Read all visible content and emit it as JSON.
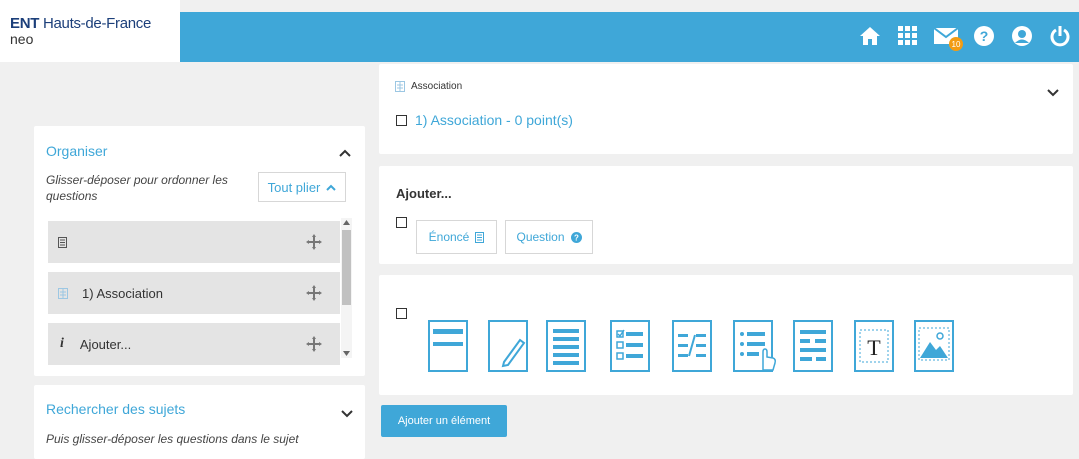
{
  "header": {
    "logo_ent": "ENT",
    "logo_region": "Hauts-de-France",
    "logo_sub": "neo",
    "icons": [
      "home-icon",
      "apps-grid-icon",
      "mail-icon",
      "help-icon",
      "user-icon",
      "power-icon"
    ],
    "mail_badge": "10"
  },
  "organiser": {
    "title": "Organiser",
    "instruction": "Glisser-déposer pour ordonner les questions",
    "collapse_button": "Tout plier",
    "items": [
      {
        "label": ""
      },
      {
        "label": "1) Association"
      },
      {
        "label": "Ajouter..."
      }
    ]
  },
  "recherche": {
    "title": "Rechercher des sujets",
    "instruction": "Puis glisser-déposer les questions dans le sujet"
  },
  "association_card": {
    "type_label": "Association",
    "question_title": "1) Association - 0 point(s)"
  },
  "ajouter_card": {
    "title": "Ajouter...",
    "enonce_button": "Énoncé",
    "question_button": "Question"
  },
  "elements": {
    "tiles": [
      "statement",
      "open-answer",
      "long-text",
      "multiple-choice",
      "association",
      "qcm-click",
      "fill-text",
      "text-block",
      "image"
    ]
  },
  "add_element_button": "Ajouter un élément",
  "colors": {
    "accent": "#3fa7d8",
    "brand_navy": "#1c3f7a",
    "badge": "#f39c12"
  }
}
